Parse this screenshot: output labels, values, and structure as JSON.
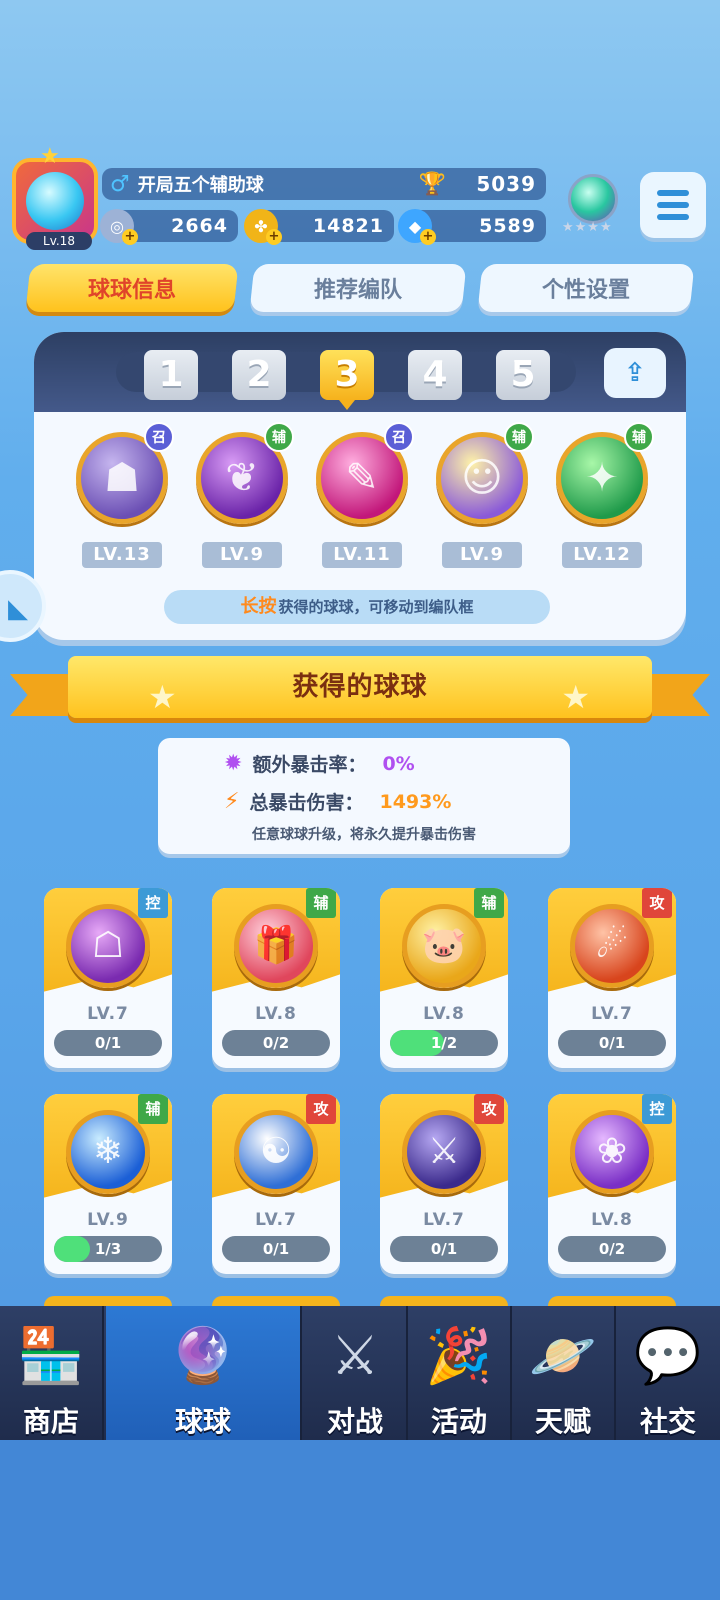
{
  "player": {
    "level_label": "Lv.18",
    "name": "开局五个辅助球",
    "trophies": "5039",
    "currency": [
      {
        "icon": "silver-coin-icon",
        "value": "2664",
        "color": "#9db2d6"
      },
      {
        "icon": "clover-coin-icon",
        "value": "14821",
        "color": "#f1b418"
      },
      {
        "icon": "diamond-icon",
        "value": "5589",
        "color": "#3ea6ff"
      }
    ]
  },
  "tabs": [
    {
      "label": "球球信息",
      "active": true
    },
    {
      "label": "推荐编队",
      "active": false
    },
    {
      "label": "个性设置",
      "active": false
    }
  ],
  "team": {
    "numbers": [
      "1",
      "2",
      "3",
      "4",
      "5"
    ],
    "selected": "3",
    "slots": [
      {
        "tag": "召",
        "tag_color": "#5b5fd6",
        "level": "LV.13",
        "colors": [
          "#c6b6ef",
          "#6b4fb4"
        ],
        "glyph": "☗",
        "icon": "ghost-ball-icon"
      },
      {
        "tag": "辅",
        "tag_color": "#3fa848",
        "level": "LV.9",
        "colors": [
          "#d89bf5",
          "#6a23a8"
        ],
        "glyph": "❦",
        "icon": "leaf-ball-icon"
      },
      {
        "tag": "召",
        "tag_color": "#5b5fd6",
        "level": "LV.11",
        "colors": [
          "#ffaedf",
          "#c2177a"
        ],
        "glyph": "✎",
        "icon": "knife-ball-icon"
      },
      {
        "tag": "辅",
        "tag_color": "#3fa848",
        "level": "LV.9",
        "colors": [
          "#fff3a8",
          "#8a5ad8"
        ],
        "glyph": "☺",
        "icon": "clone-ball-icon"
      },
      {
        "tag": "辅",
        "tag_color": "#3fa848",
        "level": "LV.12",
        "colors": [
          "#a8f7a8",
          "#1f9a4a"
        ],
        "glyph": "✦",
        "icon": "star-arrow-ball-icon"
      }
    ],
    "hint_highlight": "长按",
    "hint_text": "获得的球球，可移动到编队框"
  },
  "banner": {
    "title": "获得的球球"
  },
  "stats": {
    "crit_rate_label": "额外暴击率：",
    "crit_rate_value": "0%",
    "crit_rate_color": "#b050f0",
    "crit_damage_label": "总暴击伤害：",
    "crit_damage_value": "1493%",
    "crit_damage_color": "#ff9a1d",
    "note": "任意球球升级，将永久提升暴击伤害"
  },
  "balls": [
    {
      "tag": "控",
      "tag_color": "#3d9ad6",
      "level": "LV.7",
      "progress": "0/1",
      "fill": 0,
      "colors": [
        "#e7a9f7",
        "#7a2bb0"
      ],
      "glyph": "☖",
      "icon": "claw-ball-icon"
    },
    {
      "tag": "辅",
      "tag_color": "#3fa848",
      "level": "LV.8",
      "progress": "0/2",
      "fill": 0,
      "colors": [
        "#ffd0dc",
        "#e0465c"
      ],
      "glyph": "🎁",
      "icon": "gift-ball-icon"
    },
    {
      "tag": "辅",
      "tag_color": "#3fa848",
      "level": "LV.8",
      "progress": "1/2",
      "fill": 0.5,
      "colors": [
        "#fff2a6",
        "#e9a71a"
      ],
      "glyph": "🐷",
      "icon": "piggy-bank-ball-icon"
    },
    {
      "tag": "攻",
      "tag_color": "#e0463a",
      "level": "LV.7",
      "progress": "0/1",
      "fill": 0,
      "colors": [
        "#ffc3a6",
        "#d8451d"
      ],
      "glyph": "☄",
      "icon": "fire-ball-icon"
    },
    {
      "tag": "辅",
      "tag_color": "#3fa848",
      "level": "LV.9",
      "progress": "1/3",
      "fill": 0.333,
      "colors": [
        "#c9ecff",
        "#1b5fd6"
      ],
      "glyph": "❄",
      "icon": "ice-crystal-ball-icon"
    },
    {
      "tag": "攻",
      "tag_color": "#e0463a",
      "level": "LV.7",
      "progress": "0/1",
      "fill": 0,
      "colors": [
        "#ffffff",
        "#2f6fd6"
      ],
      "glyph": "☯",
      "icon": "yin-yang-ball-icon"
    },
    {
      "tag": "攻",
      "tag_color": "#e0463a",
      "level": "LV.7",
      "progress": "0/1",
      "fill": 0,
      "colors": [
        "#b6a8f2",
        "#3b2a8c"
      ],
      "glyph": "⚔",
      "icon": "sword-ball-icon"
    },
    {
      "tag": "控",
      "tag_color": "#3d9ad6",
      "level": "LV.8",
      "progress": "0/2",
      "fill": 0,
      "colors": [
        "#e5b8ff",
        "#7a2fc6"
      ],
      "glyph": "❀",
      "icon": "butterfly-ball-icon"
    }
  ],
  "nav": [
    {
      "label": "商店",
      "icon": "shop-icon",
      "glyph": "🏪",
      "active": false
    },
    {
      "label": "球球",
      "icon": "balls-icon",
      "glyph": "🔮",
      "active": true
    },
    {
      "label": "对战",
      "icon": "crossed-swords-icon",
      "glyph": "⚔",
      "active": false
    },
    {
      "label": "活动",
      "icon": "party-popper-icon",
      "glyph": "🎉",
      "active": false
    },
    {
      "label": "天赋",
      "icon": "planet-icon",
      "glyph": "🪐",
      "active": false
    },
    {
      "label": "社交",
      "icon": "chat-heart-icon",
      "glyph": "💬",
      "active": false
    }
  ]
}
